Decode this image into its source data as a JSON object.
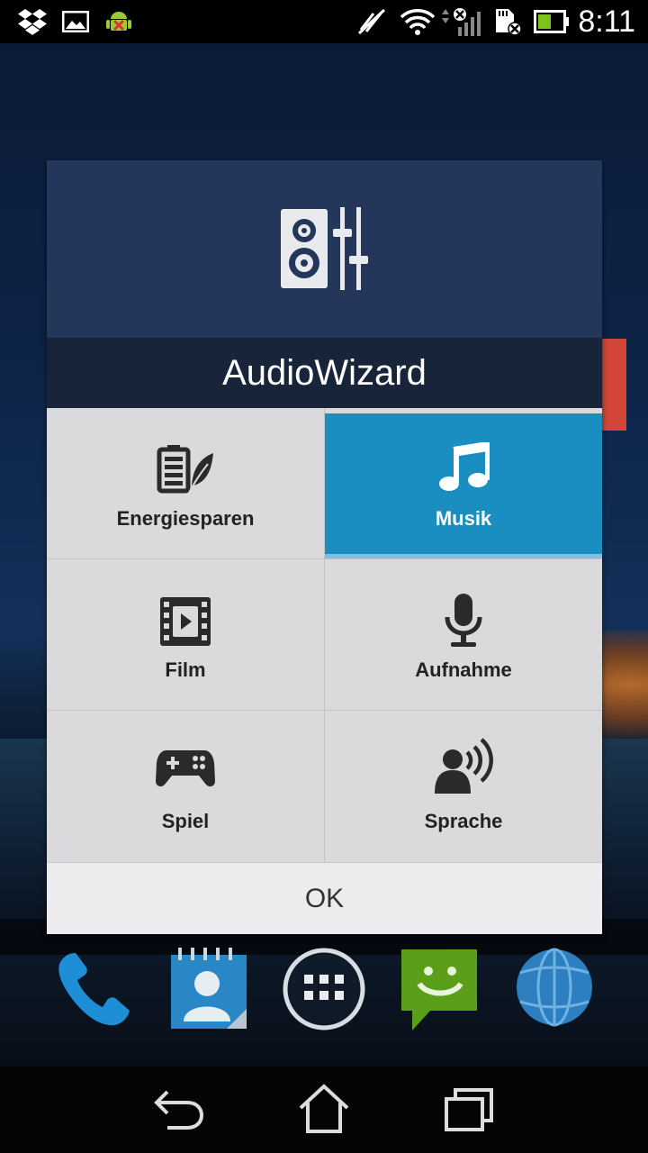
{
  "status_bar": {
    "time": "8:11",
    "icons": [
      "dropbox-icon",
      "image-icon",
      "android-debug-icon",
      "no-sound-icon",
      "wifi-icon",
      "signal-icon",
      "sd-card-icon",
      "battery-icon"
    ]
  },
  "dialog": {
    "title": "AudioWizard",
    "app_icon": "speaker-mixer-icon",
    "modes": [
      {
        "label": "Energiesparen",
        "icon": "battery-leaf-icon",
        "selected": false
      },
      {
        "label": "Musik",
        "icon": "music-note-icon",
        "selected": true
      },
      {
        "label": "Film",
        "icon": "film-icon",
        "selected": false
      },
      {
        "label": "Aufnahme",
        "icon": "microphone-icon",
        "selected": false
      },
      {
        "label": "Spiel",
        "icon": "gamepad-icon",
        "selected": false
      },
      {
        "label": "Sprache",
        "icon": "speaking-person-icon",
        "selected": false
      }
    ],
    "ok_label": "OK"
  },
  "dock": [
    "phone-icon",
    "contacts-icon",
    "app-drawer-icon",
    "messaging-icon",
    "browser-icon"
  ],
  "navigation": [
    "back-icon",
    "home-icon",
    "recent-apps-icon"
  ],
  "colors": {
    "dialog_header": "#24375b",
    "title_bar": "#17243a",
    "selected": "#1a8ec1",
    "cell_bg": "#dadadd"
  }
}
